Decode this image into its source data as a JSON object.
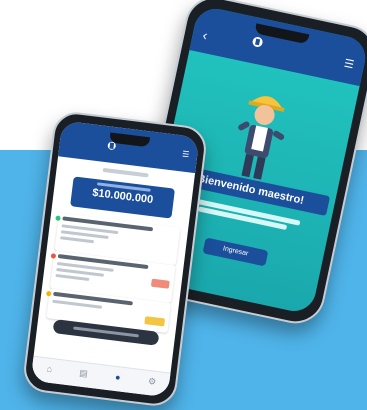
{
  "right_phone": {
    "banner": "¡Bienvenido maestro!",
    "button": "Ingresar"
  },
  "left_phone": {
    "card_amount": "$10.000.000"
  },
  "colors": {
    "brand_blue": "#1b4e9b",
    "teal": "#22c7c0",
    "background_blue": "#4fb4ea"
  }
}
